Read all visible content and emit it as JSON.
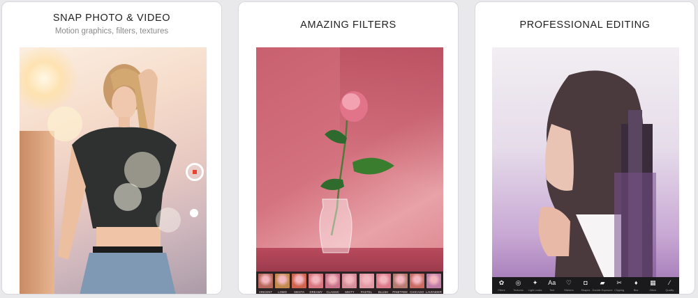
{
  "cards": [
    {
      "title": "SNAP PHOTO & VIDEO",
      "subtitle": "Motion graphics, filters, textures"
    },
    {
      "title": "AMAZING FILTERS",
      "filters": [
        {
          "label": "VINCENT",
          "color": "#b96a5e"
        },
        {
          "label": "LOMO",
          "color": "#c28a4e"
        },
        {
          "label": "SIESTA",
          "color": "#d0654f"
        },
        {
          "label": "DREAMY",
          "color": "#d97880"
        },
        {
          "label": "CLASSIC",
          "color": "#c9748c"
        },
        {
          "label": "MISTY",
          "color": "#d58f9a"
        },
        {
          "label": "PASTEL",
          "color": "#e39aa6"
        },
        {
          "label": "BLUSH",
          "color": "#dd7a8c"
        },
        {
          "label": "PINETREE",
          "color": "#b77b6f"
        },
        {
          "label": "CHICAGO",
          "color": "#c96b63"
        },
        {
          "label": "LAVENDER",
          "color": "#c07ea8"
        }
      ]
    },
    {
      "title": "PROFESSIONAL EDITING",
      "tools": [
        {
          "label": "Filters",
          "icon": "color-wheel-icon",
          "glyph": "✿"
        },
        {
          "label": "Textures",
          "icon": "texture-icon",
          "glyph": "◎"
        },
        {
          "label": "Light Leaks",
          "icon": "light-leak-icon",
          "glyph": "✦"
        },
        {
          "label": "Text",
          "icon": "text-icon",
          "glyph": "Aa"
        },
        {
          "label": "Stickers",
          "icon": "heart-icon",
          "glyph": "♡"
        },
        {
          "label": "Shapes",
          "icon": "shape-icon",
          "glyph": "◘"
        },
        {
          "label": "Double Exposure",
          "icon": "double-exposure-icon",
          "glyph": "▰"
        },
        {
          "label": "Clipping",
          "icon": "clipping-icon",
          "glyph": "✂"
        },
        {
          "label": "Blur",
          "icon": "blur-drop-icon",
          "glyph": "♦"
        },
        {
          "label": "Glitch",
          "icon": "glitch-icon",
          "glyph": "▦"
        },
        {
          "label": "Quality",
          "icon": "magic-wand-icon",
          "glyph": "⁄"
        }
      ]
    }
  ]
}
